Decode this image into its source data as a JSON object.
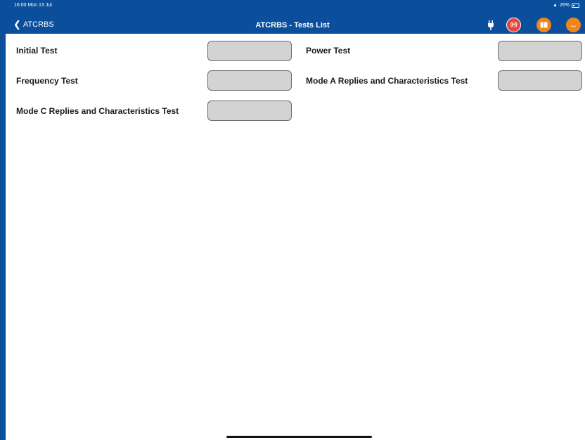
{
  "status_bar": {
    "time": "16:00  Mon 13 Jul",
    "battery": "26%"
  },
  "nav": {
    "back_label": "ATCRBS",
    "title": "ATCRBS - Tests List",
    "icons": [
      "plug-icon",
      "broadcast-icon",
      "book-icon",
      "expand-icon"
    ]
  },
  "tests": [
    {
      "label": "Initial Test",
      "value": ""
    },
    {
      "label": "Power Test",
      "value": ""
    },
    {
      "label": "Frequency Test",
      "value": ""
    },
    {
      "label": "Mode A Replies and Characteristics Test",
      "value": ""
    },
    {
      "label": "Mode C Replies and Characteristics Test",
      "value": ""
    }
  ],
  "colors": {
    "nav_bar": "#0b4f9c",
    "broadcast_button": "#e8443a",
    "orange_button": "#f0861b",
    "test_box": "#d3d3d3"
  }
}
